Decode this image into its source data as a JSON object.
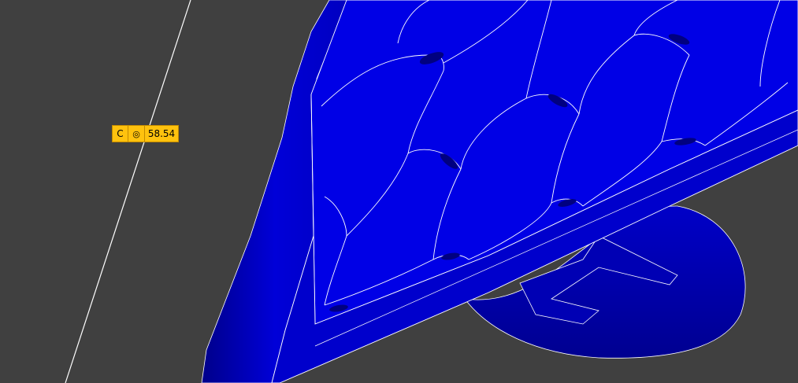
{
  "viewport": {
    "background_color": "#404040",
    "model_color": "#0000e6",
    "model_dark_color": "#00009e",
    "model_light_color": "#2a2aff",
    "edge_color": "#ffffff"
  },
  "dimension_tag": {
    "type_label": "C",
    "symbol": "◎",
    "symbol_icon": "concentricity-icon",
    "value": "58.54",
    "tag_color": "#ffc20e"
  }
}
